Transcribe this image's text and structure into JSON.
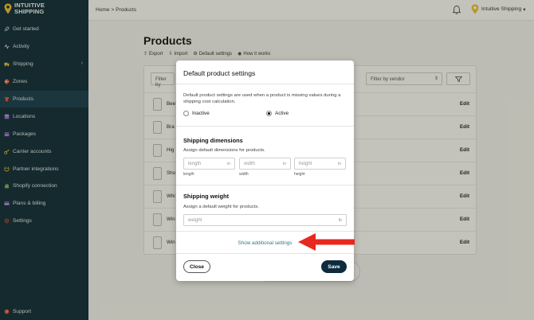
{
  "brand": {
    "line1": "INTUITIVE",
    "line2": "SHIPPING"
  },
  "sidebar": {
    "items": [
      {
        "label": "Get started",
        "icon": "rocket-icon"
      },
      {
        "label": "Activity",
        "icon": "activity-icon"
      },
      {
        "label": "Shipping",
        "icon": "truck-icon",
        "has_children": true
      },
      {
        "label": "Zones",
        "icon": "globe-icon"
      },
      {
        "label": "Products",
        "icon": "shirt-icon",
        "active": true
      },
      {
        "label": "Locations",
        "icon": "store-icon"
      },
      {
        "label": "Packages",
        "icon": "box-icon"
      },
      {
        "label": "Carrier accounts",
        "icon": "key-icon"
      },
      {
        "label": "Partner integrations",
        "icon": "plug-icon"
      },
      {
        "label": "Shopify connection",
        "icon": "shopify-icon"
      },
      {
        "label": "Plans & billing",
        "icon": "card-icon"
      },
      {
        "label": "Settings",
        "icon": "gear-icon"
      }
    ],
    "support_label": "Support"
  },
  "topbar": {
    "breadcrumb": "Home > Products",
    "account_name": "Intuitive Shipping",
    "account_chevron": "▾"
  },
  "page": {
    "title": "Products",
    "actions": {
      "export": "Export",
      "import": "Import",
      "default_settings": "Default settings",
      "how_it_works": "How it works"
    },
    "filter_placeholder": "Filter by",
    "vendor_filter": "Filter by vendor",
    "rows": [
      {
        "name": "Bee"
      },
      {
        "name": "Bra"
      },
      {
        "name": "Hig"
      },
      {
        "name": "Sho"
      },
      {
        "name": "Whi"
      },
      {
        "name": "Win"
      },
      {
        "name": "Win"
      }
    ],
    "edit_label": "Edit"
  },
  "modal": {
    "title": "Default product settings",
    "description": "Default product settings are used when a product is missing values during a shipping cost calculation.",
    "status": {
      "inactive_label": "Inactive",
      "active_label": "Active",
      "selected": "Active"
    },
    "dimensions": {
      "title": "Shipping dimensions",
      "subtitle": "Assign default dimensions for products.",
      "fields": [
        {
          "placeholder": "length",
          "unit": "in",
          "label": "length"
        },
        {
          "placeholder": "width",
          "unit": "in",
          "label": "width"
        },
        {
          "placeholder": "height",
          "unit": "in",
          "label": "height"
        }
      ]
    },
    "weight": {
      "title": "Shipping weight",
      "subtitle": "Assign a default weight for products.",
      "placeholder": "weight",
      "unit": "lb"
    },
    "show_more": "Show additional settings",
    "close_label": "Close",
    "save_label": "Save"
  },
  "colors": {
    "sidebar_bg": "#0d2b3e",
    "brand_accent": "#f2c230",
    "link": "#2a7a8c",
    "annotation_arrow": "#e8281e"
  }
}
